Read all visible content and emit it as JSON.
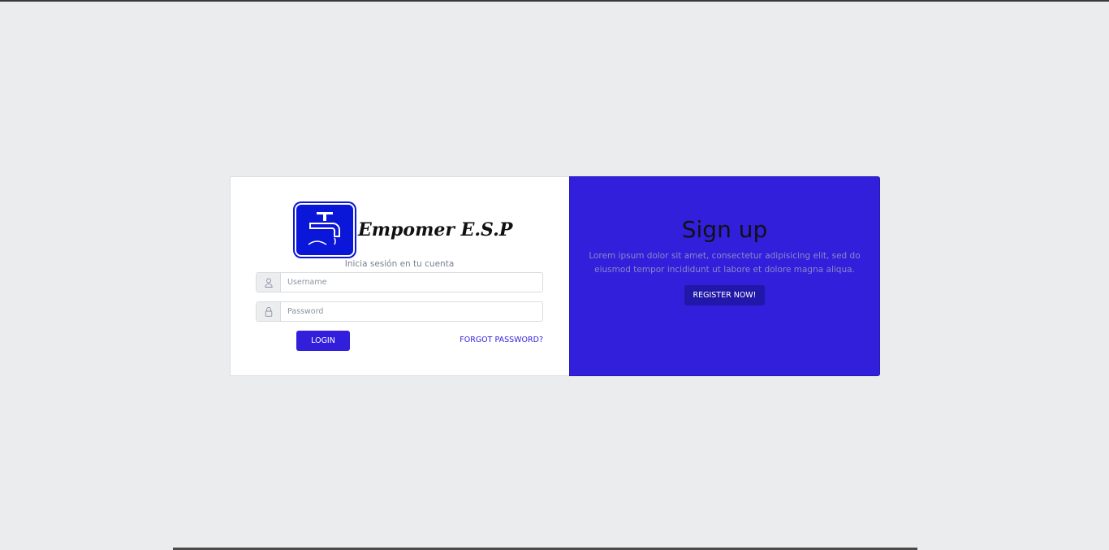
{
  "brand": {
    "name": "Empomer E.S.P",
    "logo_icon": "faucet-icon"
  },
  "login": {
    "subtitle": "Inicia sesión en tu cuenta",
    "username_placeholder": "Username",
    "password_placeholder": "Password",
    "username_icon": "user-icon",
    "password_icon": "lock-icon",
    "login_label": "LOGIN",
    "forgot_label": "FORGOT PASSWORD?"
  },
  "signup": {
    "title": "Sign up",
    "text": "Lorem ipsum dolor sit amet, consectetur adipisicing elit, sed do eiusmod tempor incididunt ut labore et dolore magna aliqua.",
    "register_label": "REGISTER NOW!"
  },
  "colors": {
    "primary": "#321fdb",
    "background": "#ebecee",
    "logo_blue": "#0a16d8"
  }
}
